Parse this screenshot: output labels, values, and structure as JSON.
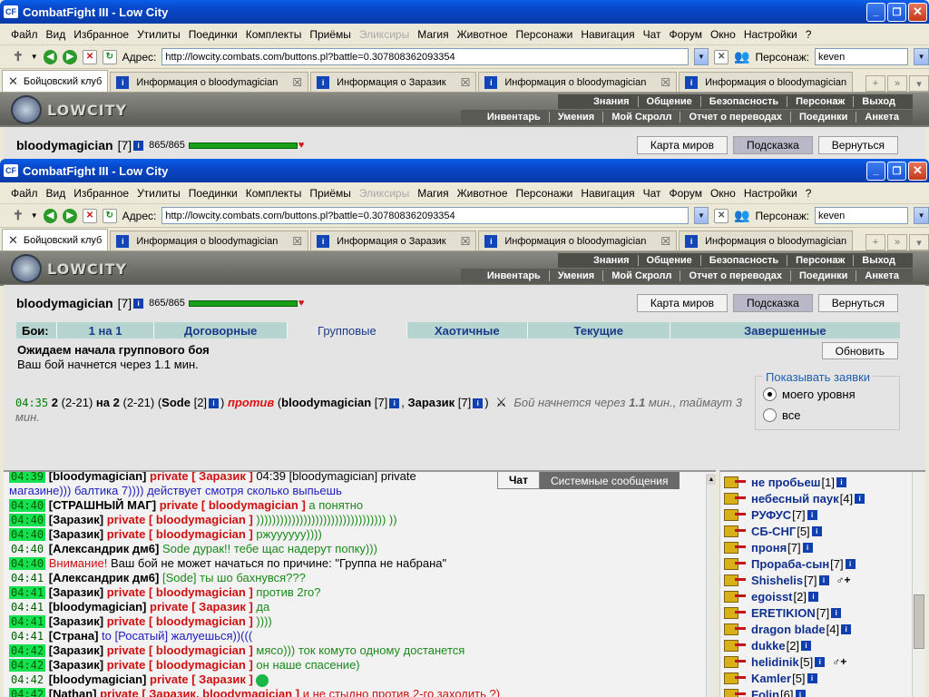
{
  "window": {
    "title": "CombatFight III - Low City",
    "icon_label": "CF",
    "controls": [
      "minimize-icon",
      "restore-icon",
      "close-icon"
    ]
  },
  "menu": [
    "Файл",
    "Вид",
    "Избранное",
    "Утилиты",
    "Поединки",
    "Комплекты",
    "Приёмы",
    "Эликсиры",
    "Магия",
    "Животное",
    "Персонажи",
    "Навигация",
    "Чат",
    "Форум",
    "Окно",
    "Настройки",
    "?"
  ],
  "menu_disabled_index": 7,
  "address": {
    "label": "Адрес:",
    "url_back": "http://lowcity.combats.com/buttons.pl?battle=0.307808362093354",
    "url_front": "http://lowcity.combats.com/buttons.pl?battle=0.307808362093354",
    "persona_label": "Персонаж:",
    "persona": "keven"
  },
  "tabs": [
    {
      "label": "Бойцовский клуб",
      "active": true
    },
    {
      "label": "Информация о bloodymagician"
    },
    {
      "label": "Информация о Заразик"
    },
    {
      "label": "Информация о bloodymagician"
    },
    {
      "label": "Информация о bloodymagician"
    }
  ],
  "tab_overflow": "»",
  "game": {
    "logo": "LOWCITY",
    "top_nav": [
      "Знания",
      "Общение",
      "Безопасность",
      "Персонаж",
      "Выход"
    ],
    "sub_nav": [
      "Инвентарь",
      "Умения",
      "Мой Скролл",
      "Отчет о переводах",
      "Поединки",
      "Анкета"
    ]
  },
  "character": {
    "name": "bloodymagician",
    "level": "[7]",
    "hp": "865/865",
    "hp_fraction": 1.0
  },
  "top_buttons": [
    "Карта миров",
    "Подсказка",
    "Вернуться"
  ],
  "battle_tabs": {
    "label": "Бои:",
    "items": [
      "1 на 1",
      "Договорные",
      "Групповые",
      "Хаотичные",
      "Текущие",
      "Завершенные"
    ],
    "active_index": 2
  },
  "wait": {
    "title": "Ожидаем начала группового боя",
    "subtitle": "Ваш бой начнется через 1.1 мин.",
    "refresh": "Обновить"
  },
  "battle": {
    "time": "04:35",
    "n1": "2",
    "r1": "(2-21)",
    "on": "на",
    "n2": "2",
    "r2": "(2-21)",
    "open1": "(",
    "team1_name": "Sode",
    "team1_level": "[2]",
    "close1": ")",
    "vs": "против",
    "open2": "(",
    "team2a_name": "bloodymagician",
    "team2a_level": "[7]",
    "comma": ",",
    "team2b_name": "Заразик",
    "team2b_level": "[7]",
    "close2": ")",
    "status_prefix": "Бой начнется через",
    "status_value": "1.1",
    "status_suffix": "мин., таймаут 3 мин."
  },
  "filter": {
    "title": "Показывать заявки",
    "options": [
      "моего уровня",
      "все"
    ],
    "selected": 0
  },
  "chat_tabs": [
    "Чат",
    "Системные сообщения"
  ],
  "chat": [
    {
      "time": "04:39",
      "hl": true,
      "nick": "[bloodymagician]",
      "priv": "private [ Заразик ]",
      "msg": "04:39 [bloodymagician] private",
      "cls": "msg-black"
    },
    {
      "time": "",
      "hl": false,
      "nick": "",
      "priv": "",
      "msg": "магазине))) балтика 7)))) действует смотря сколько выпьешь",
      "cls": "msg-blue"
    },
    {
      "time": "04:40",
      "hl": true,
      "nick": "[СТРАШНЫЙ МАГ]",
      "priv": "private [ bloodymagician ]",
      "msg": "а понятно",
      "cls": "msg-green"
    },
    {
      "time": "04:40",
      "hl": true,
      "nick": "[Заразик]",
      "priv": "private [ bloodymagician ]",
      "msg": "))))))))))))))))))))))))))))))))) ))",
      "cls": "msg-green"
    },
    {
      "time": "04:40",
      "hl": true,
      "nick": "[Заразик]",
      "priv": "private [ bloodymagician ]",
      "msg": "ржуууууу))))",
      "cls": "msg-green"
    },
    {
      "time": "04:40",
      "hl": false,
      "nick": "[Александрик дм6]",
      "priv": "",
      "msg": "Sode дурак!! тебе щас надерут попку)))",
      "cls": "msg-green"
    },
    {
      "time": "04:40",
      "hl": true,
      "nick": "",
      "priv": "",
      "msg_red": "Внимание!",
      "msg": "Ваш бой не может начаться по причине: \"Группа не набрана\"",
      "cls": "msg-black"
    },
    {
      "time": "04:41",
      "hl": false,
      "nick": "[Александрик дм6]",
      "priv": "",
      "msg": "[Sode] ты шо бахнувся???",
      "cls": "msg-green"
    },
    {
      "time": "04:41",
      "hl": true,
      "nick": "[Заразик]",
      "priv": "private [ bloodymagician ]",
      "msg": "против 2го?",
      "cls": "msg-green"
    },
    {
      "time": "04:41",
      "hl": false,
      "nick": "[bloodymagician]",
      "priv": "private [ Заразик ]",
      "msg": "да",
      "cls": "msg-green"
    },
    {
      "time": "04:41",
      "hl": true,
      "nick": "[Заразик]",
      "priv": "private [ bloodymagician ]",
      "msg": "))))",
      "cls": "msg-green"
    },
    {
      "time": "04:41",
      "hl": false,
      "nick": "[Страна]",
      "priv": "",
      "msg": "to [Росатый] жалуешься))(((",
      "cls": "msg-blue"
    },
    {
      "time": "04:42",
      "hl": true,
      "nick": "[Заразик]",
      "priv": "private [ bloodymagician ]",
      "msg": "мясо))) ток комуто одному достанется",
      "cls": "msg-green"
    },
    {
      "time": "04:42",
      "hl": true,
      "nick": "[Заразик]",
      "priv": "private [ bloodymagician ]",
      "msg": "он наше спасение)",
      "cls": "msg-green"
    },
    {
      "time": "04:42",
      "hl": false,
      "nick": "[bloodymagician]",
      "priv": "private [ Заразик ]",
      "msg": "",
      "smiley": true,
      "cls": "msg-green"
    },
    {
      "time": "04:42",
      "hl": true,
      "nick": "[Nathan]",
      "priv": "private [ Заразик, bloodymagician ]",
      "msg": "и не стыдно против 2-го заходить ?)",
      "cls": "msg-red"
    }
  ],
  "online": [
    {
      "name": "не пробьеш",
      "level": "[1]"
    },
    {
      "name": "небесный паук",
      "level": "[4]"
    },
    {
      "name": "РУФУС",
      "level": "[7]"
    },
    {
      "name": "СБ-СНГ",
      "level": "[5]"
    },
    {
      "name": "проня",
      "level": "[7]"
    },
    {
      "name": "Прораба-сын",
      "level": "[7]"
    },
    {
      "name": "Shishelis",
      "level": "[7]",
      "badge": true
    },
    {
      "name": "egoisst",
      "level": "[2]"
    },
    {
      "name": "ERETIKION",
      "level": "[7]"
    },
    {
      "name": "dragon blade",
      "level": "[4]"
    },
    {
      "name": "dukke",
      "level": "[2]"
    },
    {
      "name": "helidinik",
      "level": "[5]",
      "badge": true
    },
    {
      "name": "Kamler",
      "level": "[5]"
    },
    {
      "name": "Folin",
      "level": "[6]"
    }
  ],
  "colors": {
    "titlebar": "#0846c8",
    "timestamp_highlight": "#14e050",
    "vs_red": "#e01010",
    "online_name": "#103090",
    "battle_tabs_bg": "#b6d4d0"
  }
}
